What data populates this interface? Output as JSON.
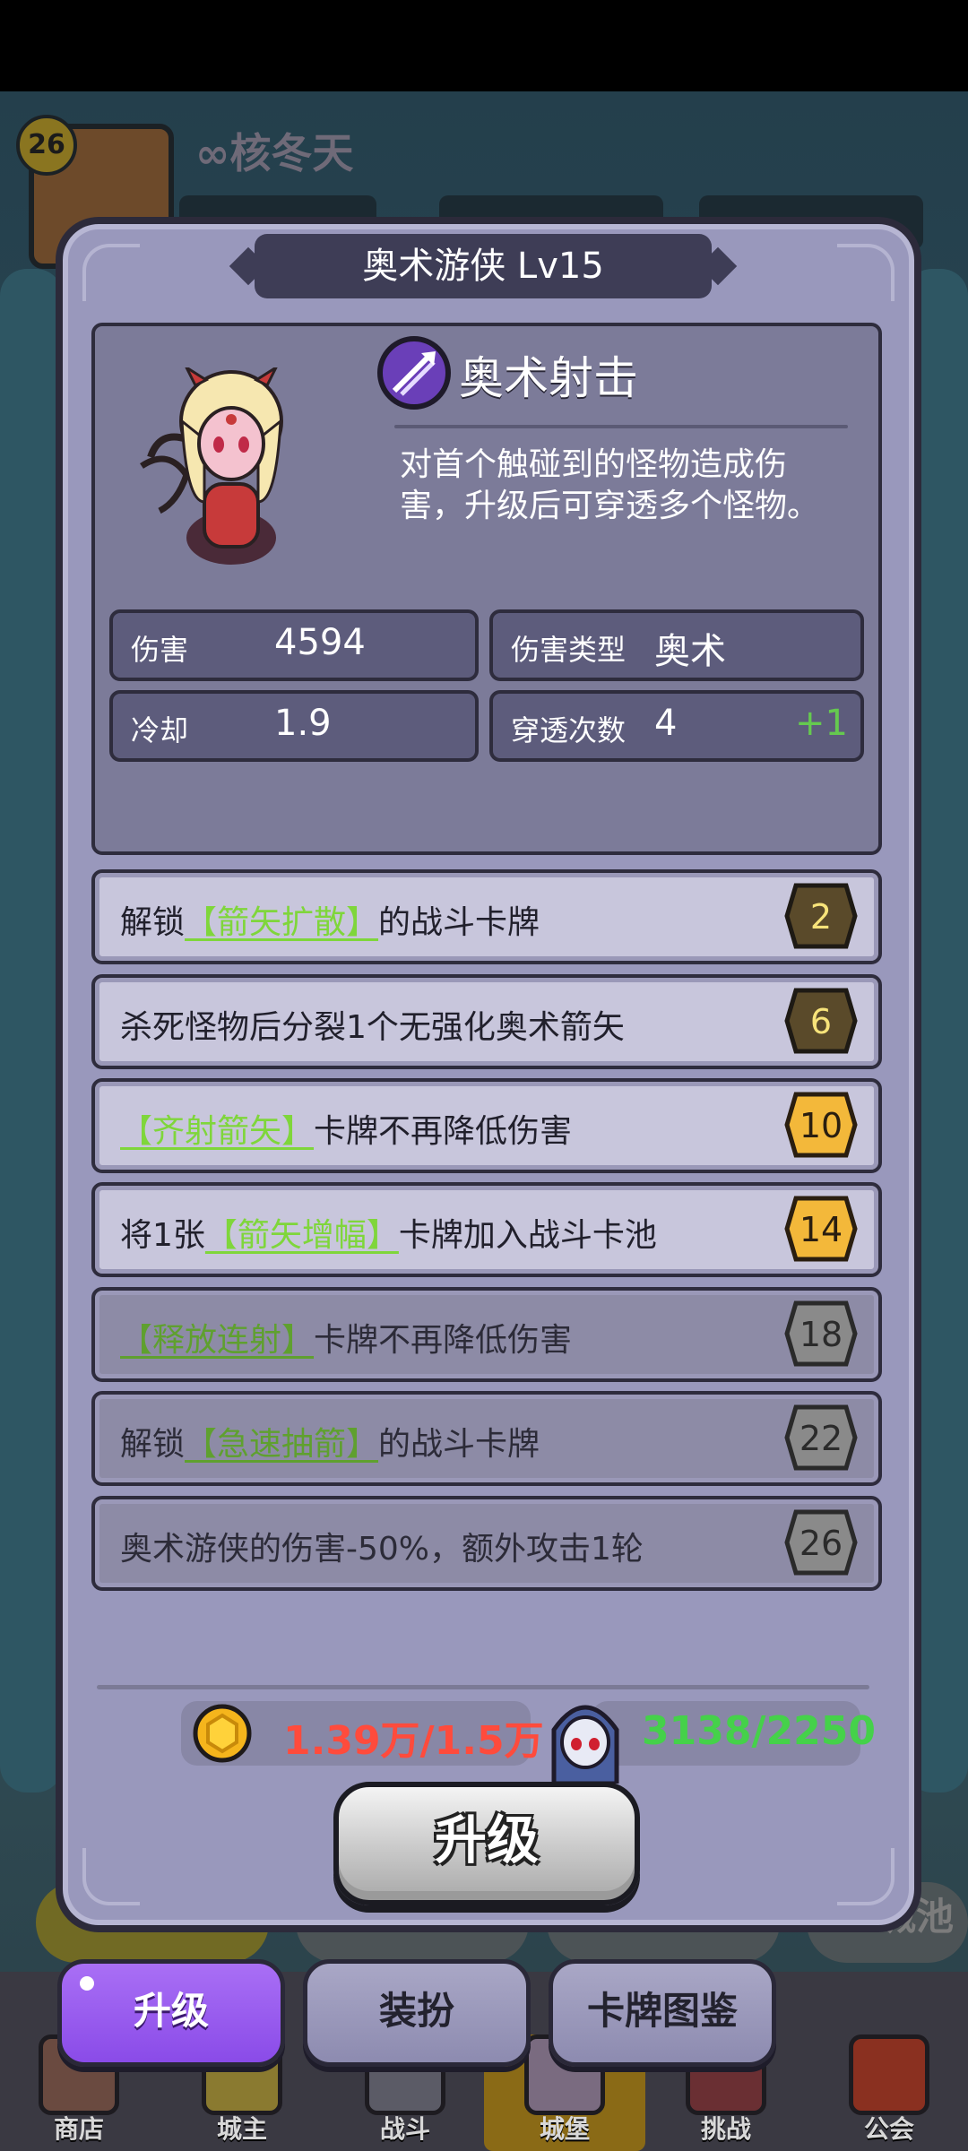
{
  "background": {
    "player_level": "26",
    "player_name": "核冬天",
    "infinity_badge": "∞",
    "city_button": "城池"
  },
  "dialog": {
    "title": "奥术游侠  Lv15",
    "skill": {
      "name": "奥术射击",
      "description": "对首个触碰到的怪物造成伤害，升级后可穿透多个怪物。"
    },
    "stats": {
      "damage_label": "伤害",
      "damage_value": "4594",
      "damage_type_label": "伤害类型",
      "damage_type_value": "奥术",
      "cooldown_label": "冷却",
      "cooldown_value": "1.9",
      "pierce_label": "穿透次数",
      "pierce_value": "4",
      "pierce_bonus": "+1"
    },
    "upgrades": [
      {
        "pre": "解锁",
        "card": "【箭矢扩散】",
        "post": "的战斗卡牌",
        "level": "2",
        "unlocked": true
      },
      {
        "pre": "杀死怪物后分裂1个无强化奥术箭矢",
        "card": "",
        "post": "",
        "level": "6",
        "unlocked": true
      },
      {
        "pre": "",
        "card": "【齐射箭矢】",
        "post": "卡牌不再降低伤害",
        "level": "10",
        "unlocked": true
      },
      {
        "pre": "将1张",
        "card": "【箭矢增幅】",
        "post": "卡牌加入战斗卡池",
        "level": "14",
        "unlocked": true
      },
      {
        "pre": "",
        "card": "【释放连射】",
        "post": "卡牌不再降低伤害",
        "level": "18",
        "unlocked": false
      },
      {
        "pre": "解锁",
        "card": "【急速抽箭】",
        "post": "的战斗卡牌",
        "level": "22",
        "unlocked": false
      },
      {
        "pre": "奥术游侠的伤害-50%，额外攻击1轮",
        "card": "",
        "post": "",
        "level": "26",
        "unlocked": false
      }
    ],
    "gold_cost": "1.39万/1.5万",
    "exp_cost": "3138/2250",
    "upgrade_button": "升级"
  },
  "tabs": [
    {
      "label": "升级",
      "active": true
    },
    {
      "label": "装扮",
      "active": false
    },
    {
      "label": "卡牌图鉴",
      "active": false
    }
  ],
  "nav": [
    {
      "label": "商店",
      "icon": "shop-icon"
    },
    {
      "label": "城主",
      "icon": "lord-icon"
    },
    {
      "label": "战斗",
      "icon": "battle-icon"
    },
    {
      "label": "城堡",
      "icon": "castle-icon"
    },
    {
      "label": "挑战",
      "icon": "challenge-icon"
    },
    {
      "label": "公会",
      "icon": "guild-icon"
    }
  ],
  "colors": {
    "dialog_bg": "#9998bc",
    "card_highlight": "#7fd63b",
    "gold_cost": "#ff4b3c",
    "exp_cost": "#45d14a",
    "active_tab": "#8a4be8"
  }
}
